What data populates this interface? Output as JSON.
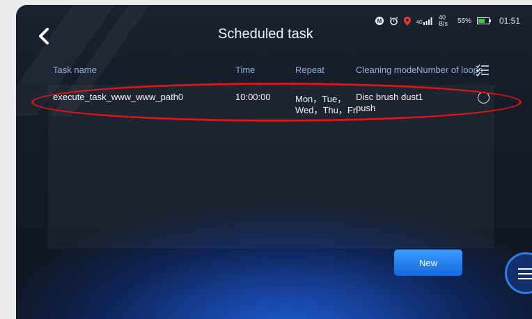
{
  "page": {
    "title": "Scheduled task"
  },
  "status_bar": {
    "network_type": "4G",
    "speed_value": "40",
    "speed_unit": "B/s",
    "battery": "55%",
    "time": "01:51",
    "icons": [
      "m-badge-icon",
      "alarm-icon",
      "location-icon",
      "signal-icon"
    ]
  },
  "table": {
    "columns": [
      "Task name",
      "Time",
      "Repeat",
      "Cleaning mode",
      "Number of loops"
    ],
    "rows": [
      {
        "task_name": "execute_task_www_www_path0",
        "time": "10:00:00",
        "repeat_line1": "Mon，Tue，",
        "repeat_line2": "Wed，Thu，Fri",
        "cleaning_mode_line1": "Disc brush dust",
        "cleaning_mode_line2": "push",
        "loops": "1"
      }
    ]
  },
  "buttons": {
    "new_label": "New"
  },
  "colors": {
    "accent": "#2a85f5",
    "highlight": "#e01414",
    "header_text": "#8fb0d6"
  }
}
